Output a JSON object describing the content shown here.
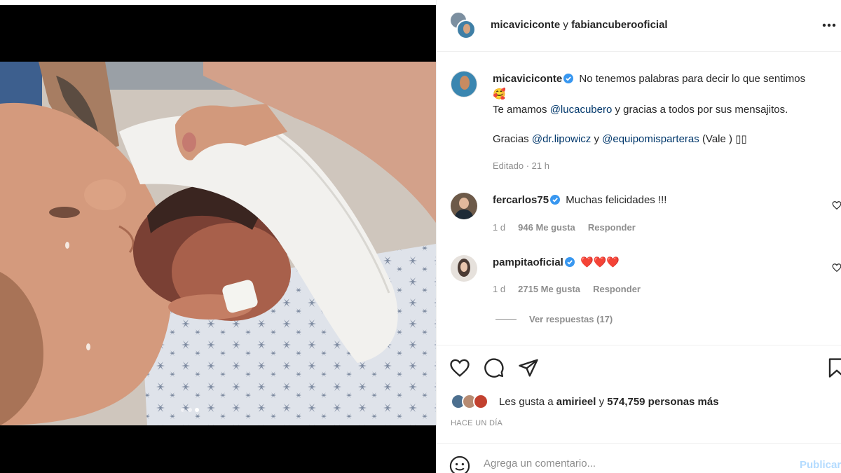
{
  "header": {
    "user1": "micaviciconte",
    "connector": "y",
    "user2": "fabiancuberooficial",
    "more_icon": "more-horizontal-icon"
  },
  "caption": {
    "username": "micaviciconte",
    "line1": "No tenemos palabras para decir lo que sentimos",
    "emoji": "🥰",
    "line2_a": "Te amamos",
    "mention1": "@lucacubero",
    "line2_b": "y gracias a todos por sus mensajitos.",
    "line3_a": "Gracias",
    "mention2": "@dr.lipowicz",
    "line3_b": "y",
    "mention3": "@equipomisparteras",
    "line3_c": "(Vale ) ▯▯",
    "edited": "Editado · 21 h"
  },
  "comments": [
    {
      "username": "fercarlos75",
      "text": "Muchas felicidades !!!",
      "time": "1 d",
      "likes": "946 Me gusta",
      "reply": "Responder"
    },
    {
      "username": "pampitaoficial",
      "text": "❤️❤️❤️",
      "time": "1 d",
      "likes": "2715 Me gusta",
      "reply": "Responder",
      "replies_label": "Ver respuestas (17)"
    }
  ],
  "likes": {
    "prefix": "Les gusta a",
    "user": "amirieel",
    "connector": "y",
    "others": "574,759 personas más"
  },
  "time_ago": "HACE UN DÍA",
  "comment_box": {
    "placeholder": "Agrega un comentario...",
    "publish_label": "Publicar"
  },
  "colors": {
    "verified": "#3897f0",
    "link": "#00376b",
    "muted": "#8e8e8e",
    "heart": "#ed4956"
  },
  "carousel": {
    "total": 3,
    "active": 3
  }
}
